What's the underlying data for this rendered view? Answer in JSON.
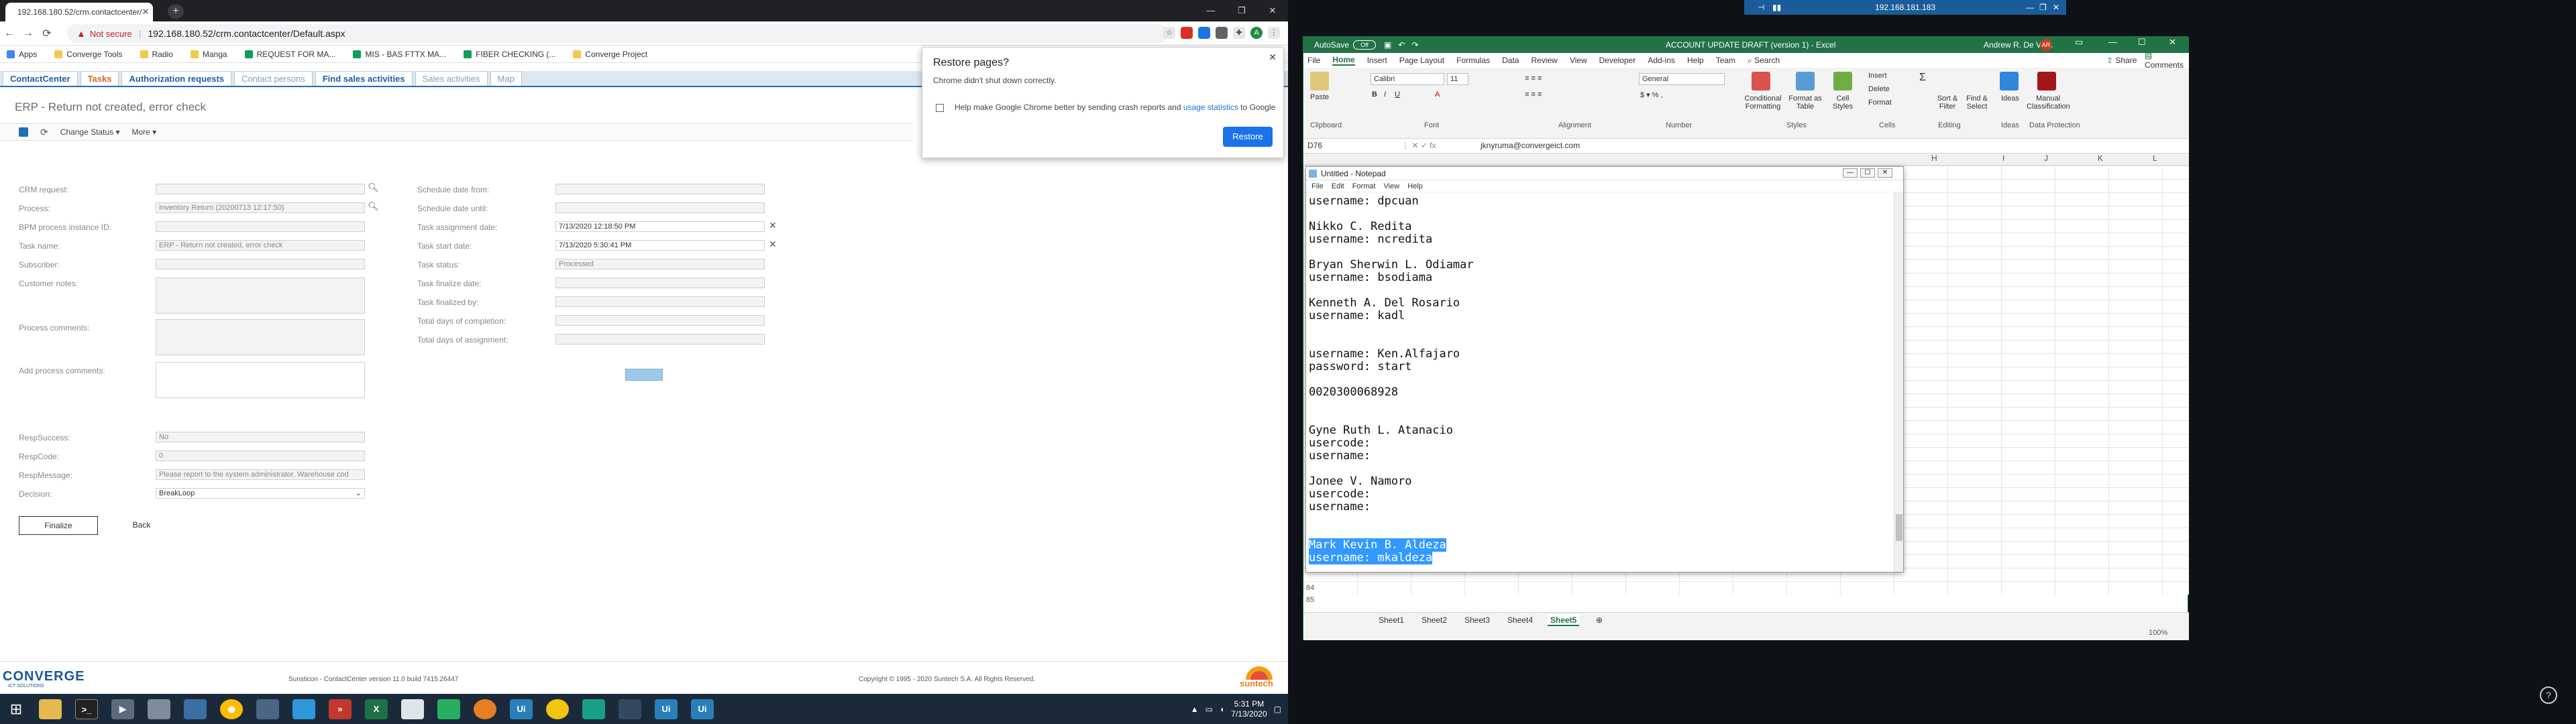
{
  "chrome": {
    "tab_title": "192.168.180.52/crm.contactcenter/",
    "not_secure": "Not secure",
    "url": "192.168.180.52/crm.contactcenter/Default.aspx",
    "bookmarks": [
      "Apps",
      "Converge Tools",
      "Radio",
      "Manga",
      "REQUEST FOR MA...",
      "MIS - BAS FTTX MA...",
      "FIBER CHECKING (...",
      "Converge Project"
    ]
  },
  "app": {
    "nav_tabs": [
      "ContactCenter",
      "Tasks",
      "Authorization requests",
      "Contact persons",
      "Find sales activities",
      "Sales activities",
      "Map"
    ],
    "page_title": "ERP - Return not created, error check",
    "actions": {
      "change_status": "Change Status ▾",
      "more": "More ▾"
    },
    "left_fields": [
      {
        "label": "CRM request:",
        "value": ""
      },
      {
        "label": "Process:",
        "value": "Inventory Return (20200713 12:17:50)"
      },
      {
        "label": "BPM process instance ID:",
        "value": ""
      },
      {
        "label": "Task name:",
        "value": "ERP - Return not created, error check"
      },
      {
        "label": "Subscriber:",
        "value": ""
      },
      {
        "label": "Customer notes:",
        "value": ""
      },
      {
        "label": "Process comments:",
        "value": ""
      },
      {
        "label": "Add process comments:",
        "value": ""
      }
    ],
    "right_fields": [
      {
        "label": "Schedule date from:",
        "value": ""
      },
      {
        "label": "Schedule date until:",
        "value": ""
      },
      {
        "label": "Task assignment date:",
        "value": "7/13/2020 12:18:50 PM"
      },
      {
        "label": "Task start date:",
        "value": "7/13/2020 5:30:41 PM"
      },
      {
        "label": "Task status:",
        "value": "Processed"
      },
      {
        "label": "Task finalize date:",
        "value": ""
      },
      {
        "label": "Task finalized by:",
        "value": ""
      },
      {
        "label": "Total days of completion:",
        "value": ""
      },
      {
        "label": "Total days of assignment:",
        "value": ""
      }
    ],
    "resp_fields": [
      {
        "label": "RespSuccess:",
        "value": "No"
      },
      {
        "label": "RespCode:",
        "value": "0"
      },
      {
        "label": "RespMessage:",
        "value": "Please report to the system administrator. Warehouse cod"
      },
      {
        "label": "Decision:",
        "value": "BreakLoop"
      }
    ],
    "finalize": "Finalize",
    "back": "Back",
    "footer_version": "Sunsticon - ContactCenter version 11.0 build 7415.26447",
    "footer_copyright": "Copyright © 1995 - 2020 Suntech S.A. All Rights Reserved.",
    "logo": "CONVERGE",
    "logo_sub": "ICT SOLUTIONS",
    "suntech": "suntech"
  },
  "restore_popup": {
    "title": "Restore pages?",
    "body": "Chrome didn't shut down correctly.",
    "checkbox_text": "Help make Google Chrome better by sending crash reports and ",
    "link": "usage statistics",
    "checkbox_tail": " to Google",
    "button": "Restore"
  },
  "taskbar": {
    "time": "5:31 PM",
    "date": "7/13/2020"
  },
  "rdp": {
    "title": "192.168.181.183"
  },
  "excel": {
    "autosave": "AutoSave",
    "autosave_state": "Off",
    "doc_title": "ACCOUNT UPDATE DRAFT (version 1) - Excel",
    "user": "Andrew R. De Vera",
    "user_initials": "AR",
    "tabs": [
      "File",
      "Home",
      "Insert",
      "Page Layout",
      "Formulas",
      "Data",
      "Review",
      "View",
      "Developer",
      "Add-ins",
      "Help",
      "Team",
      "Search"
    ],
    "share": "Share",
    "comments": "Comments",
    "font_name": "Calibri",
    "font_size": "11",
    "number_format": "General",
    "groups": [
      "Clipboard",
      "Font",
      "Alignment",
      "Number",
      "Styles",
      "Cells",
      "Editing",
      "Ideas",
      "Data Protection"
    ],
    "ribbon_buttons": [
      "Paste",
      "Conditional Formatting",
      "Format as Table",
      "Cell Styles",
      "Insert",
      "Delete",
      "Format",
      "Sort & Filter",
      "Find & Select",
      "Ideas",
      "Manual Classification"
    ],
    "name_box": "D76",
    "formula": "jknyruma@convergeict.com",
    "col_headers": [
      "H",
      "I",
      "J",
      "K",
      "L"
    ],
    "row_numbers": [
      "84",
      "85"
    ],
    "sheets": [
      "Sheet1",
      "Sheet2",
      "Sheet3",
      "Sheet4",
      "Sheet5"
    ],
    "zoom": "100%"
  },
  "notepad": {
    "title": "Untitled - Notepad",
    "menu": [
      "File",
      "Edit",
      "Format",
      "View",
      "Help"
    ],
    "lines_before": [
      "username: dpcuan",
      "",
      "Nikko C. Redita",
      "username: ncredita",
      "",
      "Bryan Sherwin L. Odiamar",
      "username: bsodiama",
      "",
      "Kenneth A. Del Rosario",
      "username: kadl",
      "",
      "",
      "username: Ken.Alfajaro",
      "password: start",
      "",
      "0020300068928",
      "",
      "",
      "Gyne Ruth L. Atanacio",
      "usercode:",
      "username:",
      "",
      "Jonee V. Namoro",
      "usercode:",
      "username:",
      "",
      ""
    ],
    "selected_lines": [
      "Mark Kevin B. Aldeza",
      "username: mkaldeza"
    ]
  }
}
